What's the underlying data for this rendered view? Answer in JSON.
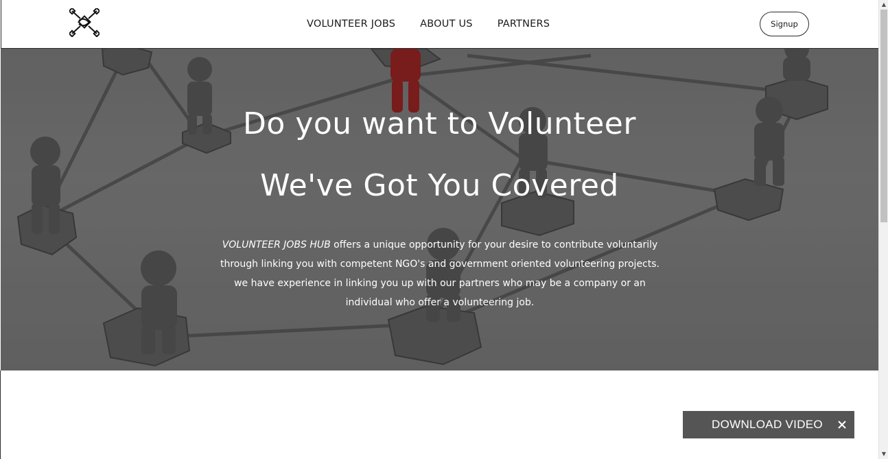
{
  "header": {
    "logo_icon": "volunteer-hands-logo",
    "nav": [
      {
        "label": "VOLUNTEER JOBS"
      },
      {
        "label": "ABOUT US"
      },
      {
        "label": "PARTNERS"
      }
    ],
    "signup_label": "Signup"
  },
  "hero": {
    "title_line1": "Do you want to Volunteer",
    "title_line2": "We've Got You Covered",
    "brand_name": "VOLUNTEER JOBS HUB",
    "description": " offers a unique opportunity for your desire to contribute voluntarily through linking you with competent NGO's and government oriented volunteering projects. we have experience in linking you up with our partners who may be a company or an individual who offer a volunteering job.",
    "background": "network-of-people-figures"
  },
  "download_widget": {
    "label": "DOWNLOAD VIDEO",
    "close_icon": "close-icon"
  },
  "colors": {
    "header_bg": "#ffffff",
    "hero_overlay": "#6e6e6e",
    "download_bg": "#555555",
    "accent_figure": "#8b1a1a"
  }
}
